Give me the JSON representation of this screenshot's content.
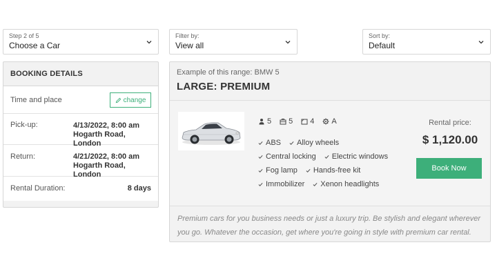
{
  "dropdowns": {
    "step": {
      "label": "Step 2 of 5",
      "value": "Choose a Car"
    },
    "filter": {
      "label": "Filter by:",
      "value": "View all"
    },
    "sort": {
      "label": "Sort by:",
      "value": "Default"
    }
  },
  "booking": {
    "title": "BOOKING DETAILS",
    "time_place_label": "Time and place",
    "change_label": "change",
    "pickup_label": "Pick-up:",
    "pickup_date": "4/13/2022, 8:00 am",
    "pickup_location": "Hogarth Road, London",
    "return_label": "Return:",
    "return_date": "4/21/2022, 8:00 am",
    "return_location": "Hogarth Road, London",
    "duration_label": "Rental Duration:",
    "duration_value": "8 days"
  },
  "car": {
    "example": "Example of this range: BMW 5",
    "range": "LARGE: PREMIUM",
    "specs": {
      "passengers": "5",
      "bags": "5",
      "doors": "4",
      "transmission": "A"
    },
    "features": [
      [
        "ABS",
        "Alloy wheels"
      ],
      [
        "Central locking",
        "Electric windows"
      ],
      [
        "Fog lamp",
        "Hands-free kit"
      ],
      [
        "Immobilizer",
        "Xenon headlights"
      ]
    ],
    "price_label": "Rental price:",
    "price": "$ 1,120.00",
    "book_label": "Book Now",
    "description": "Premium cars for you business needs or just a luxury trip. Be stylish and elegant wherever you go. Whatever the occasion, get where you're going in style with premium car rental."
  },
  "colors": {
    "accent": "#3daf7a",
    "panel": "#f2f2f2",
    "border": "#d6d6d6"
  },
  "icons": [
    "chevron-down-icon",
    "pencil-icon",
    "person-icon",
    "suitcase-icon",
    "door-icon",
    "gear-icon",
    "check-icon"
  ]
}
